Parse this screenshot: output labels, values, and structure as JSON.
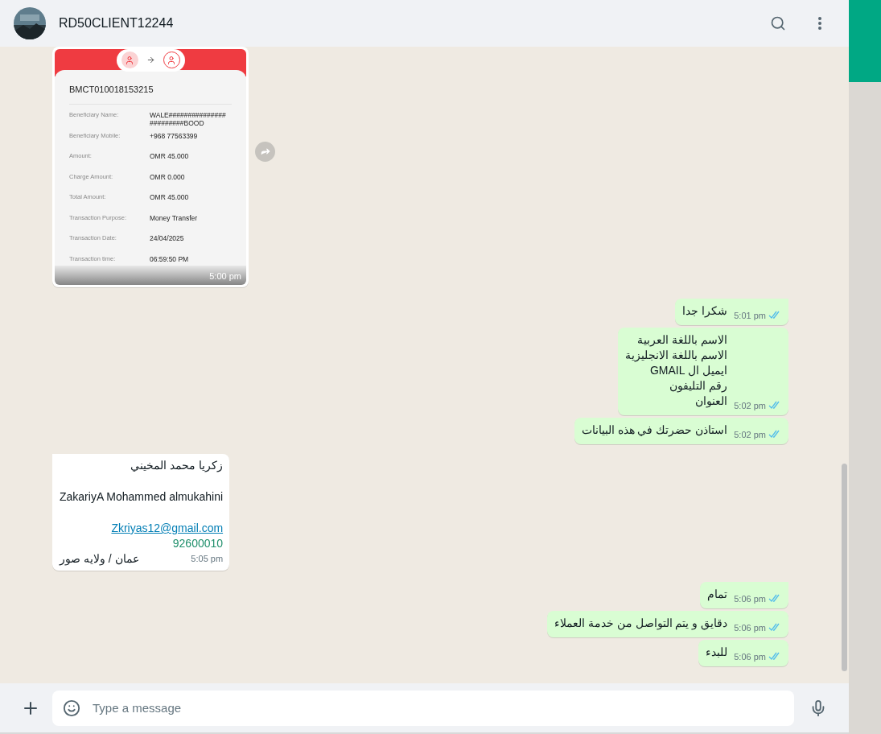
{
  "header": {
    "contact_name": "RD50CLIENT12244"
  },
  "messages": [
    {
      "kind": "receipt",
      "outgoing": false,
      "time": "5:00 pm",
      "receipt": {
        "reference": "BMCT010018153215",
        "rows": [
          {
            "label": "Beneficiary Name:",
            "value": "WALE###############\n#########BOOD"
          },
          {
            "label": "Beneficiary Mobile:",
            "value": "+968 77563399"
          },
          {
            "label": "Amount:",
            "value": "OMR 45.000"
          },
          {
            "label": "Charge Amount:",
            "value": "OMR 0.000"
          },
          {
            "label": "Total Amount:",
            "value": "OMR 45.000"
          },
          {
            "label": "Transaction Purpose:",
            "value": "Money Transfer"
          },
          {
            "label": "Transaction Date:",
            "value": "24/04/2025"
          },
          {
            "label": "Transaction time:",
            "value": "06:59:50 PM"
          }
        ]
      }
    },
    {
      "kind": "text",
      "outgoing": true,
      "first": true,
      "text": "شكرا جدا",
      "time": "5:01 pm",
      "read": true
    },
    {
      "kind": "text",
      "outgoing": true,
      "first": false,
      "text": "الاسم باللغة العربية\nالاسم باللغة الانجليزية\nايميل ال GMAIL\nرقم التليفون\nالعنوان",
      "time": "5:02 pm",
      "read": true
    },
    {
      "kind": "text",
      "outgoing": true,
      "first": false,
      "text": "استاذن حضرتك في هذه البيانات",
      "time": "5:02 pm",
      "read": true
    },
    {
      "kind": "contact",
      "outgoing": false,
      "first": true,
      "time": "5:05 pm",
      "contact": {
        "name_ar": "زكريا محمد المخيني",
        "name_en": "ZakariyA Mohammed almukahini",
        "email": "Zkriyas12@gmail.com",
        "phone": "92600010",
        "address": "عمان / ولايه صور"
      }
    },
    {
      "kind": "text",
      "outgoing": true,
      "first": true,
      "text": "تمام",
      "time": "5:06 pm",
      "read": true
    },
    {
      "kind": "text",
      "outgoing": true,
      "first": false,
      "text": "دقايق و يتم التواصل من خدمة العملاء",
      "time": "5:06 pm",
      "read": true
    },
    {
      "kind": "text",
      "outgoing": true,
      "first": false,
      "text": "للبدء",
      "time": "5:06 pm",
      "read": true
    }
  ],
  "composer": {
    "placeholder": "Type a message"
  }
}
